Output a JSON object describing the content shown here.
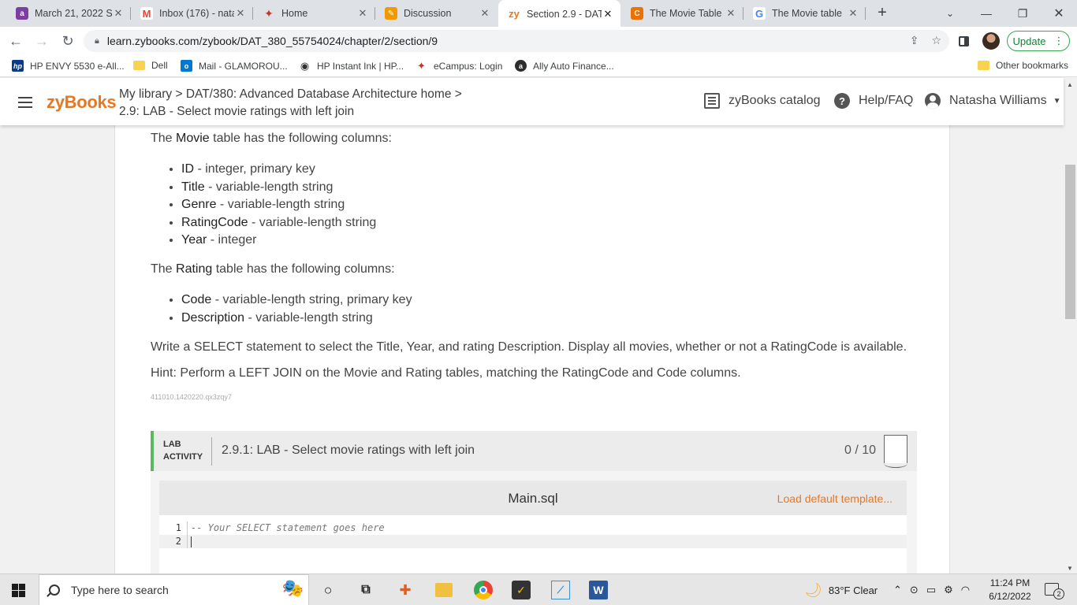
{
  "browser": {
    "tabs": [
      {
        "title": "March 21, 2022 S",
        "icon": "a-letter-icon",
        "color": "#7b3fa0",
        "glyph": "a"
      },
      {
        "title": "Inbox (176) - nata",
        "icon": "gmail-icon",
        "color": "#ea4335",
        "glyph": "M"
      },
      {
        "title": "Home",
        "icon": "ecampus-icon",
        "color": "#c0392b",
        "glyph": "✦"
      },
      {
        "title": "Discussion",
        "icon": "pencil-icon",
        "color": "#f29900",
        "glyph": "✎"
      },
      {
        "title": "Section 2.9 - DAT",
        "icon": "zybooks-icon",
        "color": "#e87722",
        "glyph": "zy"
      },
      {
        "title": "The Movie Table",
        "icon": "chegg-icon",
        "color": "#eb7100",
        "glyph": "C"
      },
      {
        "title": "The Movie table",
        "icon": "google-icon",
        "color": "#4285f4",
        "glyph": "G"
      }
    ],
    "url": "learn.zybooks.com/zybook/DAT_380_55754024/chapter/2/section/9",
    "update_label": "Update",
    "bookmarks": [
      {
        "label": "HP ENVY 5530 e-All...",
        "glyph": "hp",
        "color": "#0a3c8c"
      },
      {
        "label": "Dell",
        "glyph": "",
        "color": "folder"
      },
      {
        "label": "Mail - GLAMOROU...",
        "glyph": "o",
        "color": "#0078d4"
      },
      {
        "label": "HP Instant Ink | HP...",
        "glyph": "◉",
        "color": "#333333"
      },
      {
        "label": "eCampus: Login",
        "glyph": "✦",
        "color": "#c0392b"
      },
      {
        "label": "Ally Auto Finance...",
        "glyph": "a",
        "color": "#2d2d2d"
      }
    ],
    "other_bookmarks": "Other bookmarks"
  },
  "header": {
    "logo": "zyBooks",
    "breadcrumb_line1": "My library > DAT/380: Advanced Database Architecture home >",
    "breadcrumb_line2": "2.9: LAB - Select movie ratings with left join",
    "catalog": "zyBooks catalog",
    "help": "Help/FAQ",
    "user": "Natasha Williams"
  },
  "content": {
    "movie_intro_pre": "The ",
    "movie_intro_bold": "Movie",
    "movie_intro_post": " table has the following columns:",
    "movie_columns": [
      {
        "name": "ID",
        "desc": " - integer, primary key"
      },
      {
        "name": "Title",
        "desc": " - variable-length string"
      },
      {
        "name": "Genre",
        "desc": " - variable-length string"
      },
      {
        "name": "RatingCode",
        "desc": " - variable-length string"
      },
      {
        "name": "Year",
        "desc": " - integer"
      }
    ],
    "rating_intro_pre": "The ",
    "rating_intro_bold": "Rating",
    "rating_intro_post": " table has the following columns:",
    "rating_columns": [
      {
        "name": "Code",
        "desc": " - variable-length string, primary key"
      },
      {
        "name": "Description",
        "desc": " - variable-length string"
      }
    ],
    "instruction": "Write a SELECT statement to select the Title, Year, and rating Description. Display all movies, whether or not a RatingCode is available.",
    "hint": "Hint: Perform a LEFT JOIN on the Movie and Rating tables, matching the RatingCode and Code columns.",
    "ref_id": "411010.1420220.qx3zqy7"
  },
  "lab": {
    "tag_line1": "LAB",
    "tag_line2": "ACTIVITY",
    "title": "2.9.1: LAB - Select movie ratings with left join",
    "score": "0 / 10",
    "file": "Main.sql",
    "load_template": "Load default template...",
    "code_lines": [
      {
        "num": "1",
        "text": "-- Your SELECT statement goes here"
      },
      {
        "num": "2",
        "text": ""
      }
    ]
  },
  "taskbar": {
    "search_placeholder": "Type here to search",
    "weather": "83°F  Clear",
    "time": "11:24 PM",
    "date": "6/12/2022",
    "notification_count": "2"
  }
}
